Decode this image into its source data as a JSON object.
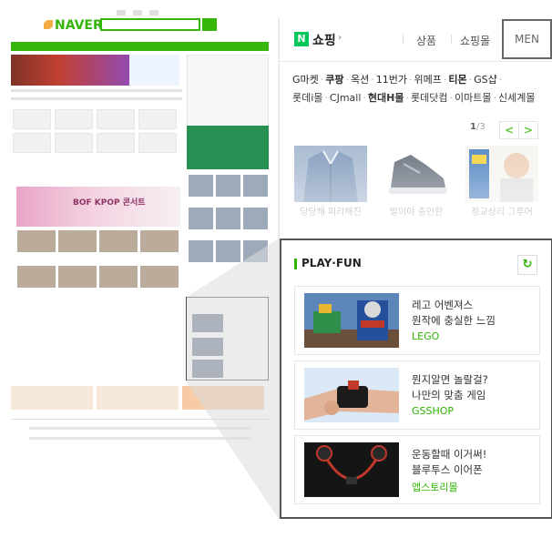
{
  "thumbnail": {
    "logo_text": "NAVER",
    "kpop_banner": "BOF KPOP 콘서트",
    "pf_label": "PLAY·FUN"
  },
  "header": {
    "n_icon": "N",
    "shopping_label": "쇼핑",
    "arrow": "›",
    "tab_product": "상품",
    "tab_mall": "쇼핑몰",
    "men_button": "MEN"
  },
  "malls": [
    {
      "label": "G마켓",
      "bold": false
    },
    {
      "label": "쿠팡",
      "bold": true
    },
    {
      "label": "옥션",
      "bold": false
    },
    {
      "label": "11번가",
      "bold": false
    },
    {
      "label": "위메프",
      "bold": false
    },
    {
      "label": "티몬",
      "bold": true
    },
    {
      "label": "GS샵",
      "bold": false
    },
    {
      "label": "롯데i몰",
      "bold": false
    },
    {
      "label": "CJmall",
      "bold": false
    },
    {
      "label": "현대H몰",
      "bold": true
    },
    {
      "label": "롯데닷컴",
      "bold": false
    },
    {
      "label": "이마트몰",
      "bold": false
    },
    {
      "label": "신세계몰",
      "bold": false
    }
  ],
  "pager": {
    "current": "1",
    "total": "/3",
    "prev_icon": "<",
    "next_icon": ">"
  },
  "products": [
    {
      "caption": "당당해 피리해진",
      "icon": "denim-jacket-image"
    },
    {
      "caption": "발이야 충인한",
      "icon": "sneaker-image"
    },
    {
      "caption": "정교상리 그루어",
      "icon": "shaver-image"
    }
  ],
  "playfun": {
    "title": "PLAY·FUN",
    "refresh_icon": "↻",
    "items": [
      {
        "line1": "레고 어벤져스",
        "line2": "원작에 충실한 느낌",
        "source": "LEGO",
        "icon": "lego-game-image"
      },
      {
        "line1": "뭔지알면 놀랄걸?",
        "line2": "나만의 맞춤 게임",
        "source": "GSSHOP",
        "icon": "wristband-image"
      },
      {
        "line1": "운동할때 이거써!",
        "line2": "블루투스 이어폰",
        "source": "앱스토리몰",
        "icon": "earphone-image"
      }
    ]
  },
  "colors": {
    "naver_green": "#2db400",
    "n_logo_green": "#03c75a",
    "highlight_border": "#555555"
  }
}
